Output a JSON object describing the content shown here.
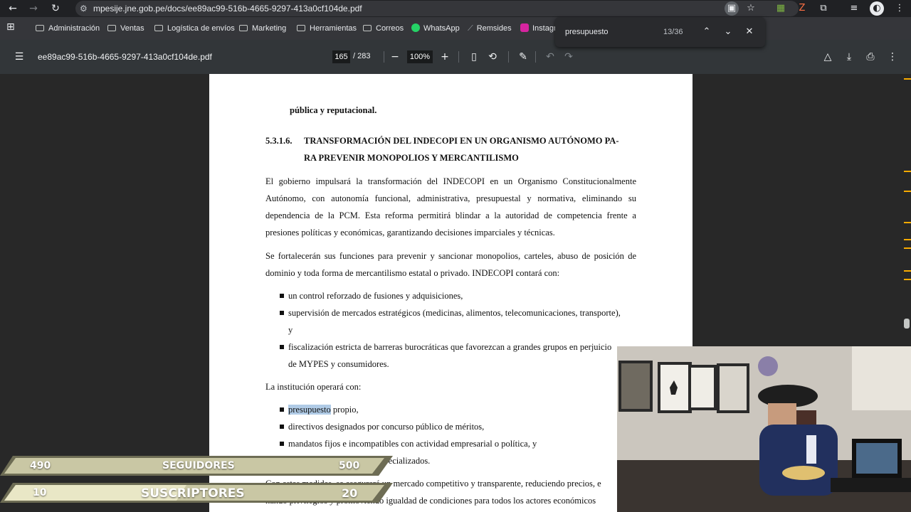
{
  "browser": {
    "url": "mpesije.jne.gob.pe/docs/ee89ac99-516b-4665-9297-413a0cf104de.pdf",
    "bookmarks": [
      "Administración",
      "Ventas",
      "Logística de envíos",
      "Marketing",
      "Herramientas",
      "Correos",
      "WhatsApp",
      "Remsides",
      "Instagr"
    ]
  },
  "find_bar": {
    "query": "presupuesto",
    "count": "13/36"
  },
  "pdf_toolbar": {
    "title": "ee89ac99-516b-4665-9297-413a0cf104de.pdf",
    "page": "165",
    "total": "/ 283",
    "zoom": "100%"
  },
  "document": {
    "prev_heading_end": "pública y reputacional.",
    "section_number": "5.3.1.6.",
    "section_title_1": "TRANSFORMACIÓN DEL INDECOPI EN UN ORGANISMO AUTÓNOMO PA-",
    "section_title_2": "RA PREVENIR MONOPOLIOS Y MERCANTILISMO",
    "p1": [
      "El gobierno impulsará la transformación del INDECOPI en un Organismo Constitucionalmente",
      "Autónomo, con autonomía funcional, administrativa, presupuestal y normativa, eliminando su",
      "dependencia de la PCM. Esta reforma permitirá blindar a la autoridad de competencia frente a",
      "presiones políticas y económicas, garantizando decisiones imparciales y técnicas."
    ],
    "p2": [
      "Se fortalecerán sus funciones para prevenir y sancionar monopolios, carteles, abuso de posición de",
      "dominio y toda forma de mercantilismo estatal o privado. INDECOPI contará con:"
    ],
    "list1": [
      "un control reforzado de fusiones y adquisiciones,",
      "supervisión de mercados estratégicos (medicinas, alimentos, telecomunicaciones, transporte),",
      "y",
      "fiscalización estricta de barreras burocráticas que favorezcan a grandes grupos en perjuicio",
      "de MYPES y consumidores."
    ],
    "p3": "La institución operará con:",
    "list2_highlight": "presupuesto",
    "list2_first_rest": " propio,",
    "list2": [
      "directivos designados por concurso público de méritos,",
      "mandatos fijos e incompatibles con actividad empresarial o política, y",
      "especializados."
    ],
    "p4": [
      "Con estas medidas, se asegurará un mercado competitivo y transparente, reduciendo precios, e",
      "nando privilegios y promoviendo igualdad de condiciones para todos los actores económicos"
    ]
  },
  "stream_overlay": {
    "row1": {
      "current": "490",
      "label": "SEGUIDORES",
      "goal": "500"
    },
    "row2": {
      "current": "10",
      "label": "SUSCRIPTORES",
      "goal": "20"
    }
  },
  "colors": {
    "highlight": "#b0cbe6",
    "toolbar": "#323639",
    "find_marks": "#f9ab00"
  }
}
